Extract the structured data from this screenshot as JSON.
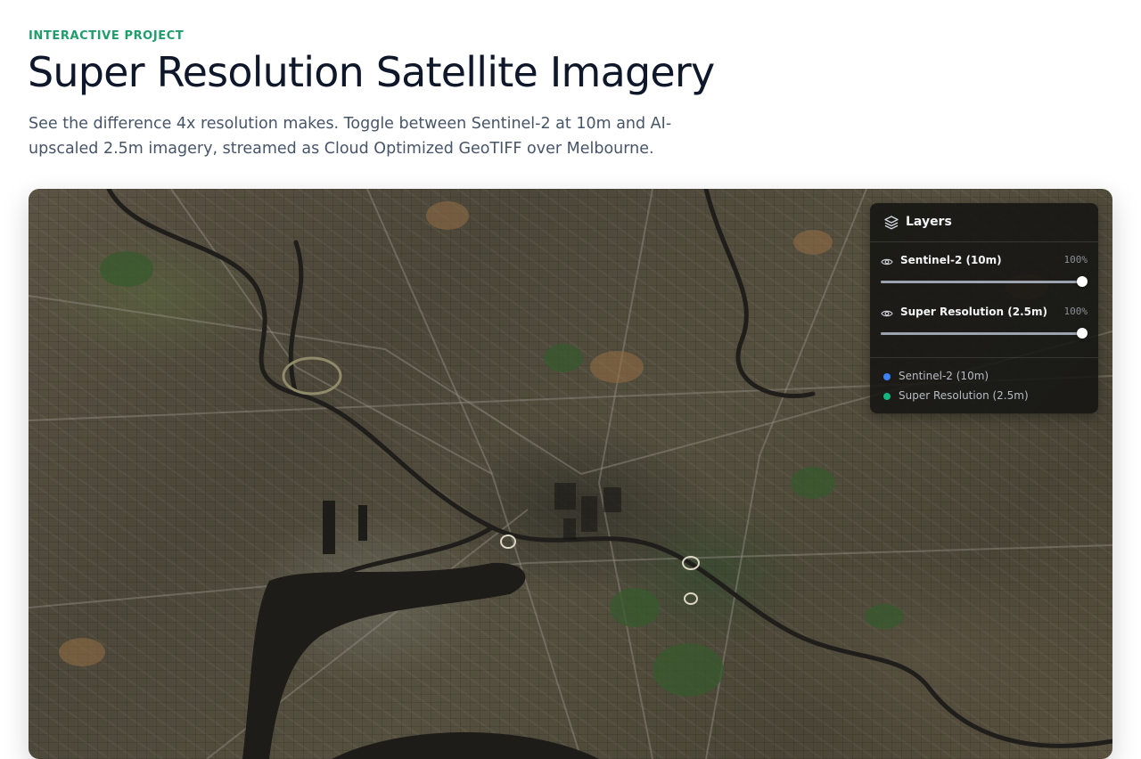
{
  "header": {
    "eyebrow": "INTERACTIVE PROJECT",
    "title": "Super Resolution Satellite Imagery",
    "description": "See the difference 4x resolution makes. Toggle between Sentinel-2 at 10m and AI-upscaled 2.5m imagery, streamed as Cloud Optimized GeoTIFF over Melbourne."
  },
  "layers_panel": {
    "title": "Layers",
    "icon": "layers-icon",
    "layers": [
      {
        "name": "Sentinel-2 (10m)",
        "opacity_label": "100%",
        "opacity": 1.0,
        "icon": "eye-icon"
      },
      {
        "name": "Super Resolution (2.5m)",
        "opacity_label": "100%",
        "opacity": 1.0,
        "icon": "eye-icon"
      }
    ],
    "legend": [
      {
        "label": "Sentinel-2 (10m)",
        "color": "#3b82f6"
      },
      {
        "label": "Super Resolution (2.5m)",
        "color": "#10b981"
      }
    ]
  },
  "colors": {
    "accent": "#1f9d6b",
    "panel_bg": "#141412"
  }
}
